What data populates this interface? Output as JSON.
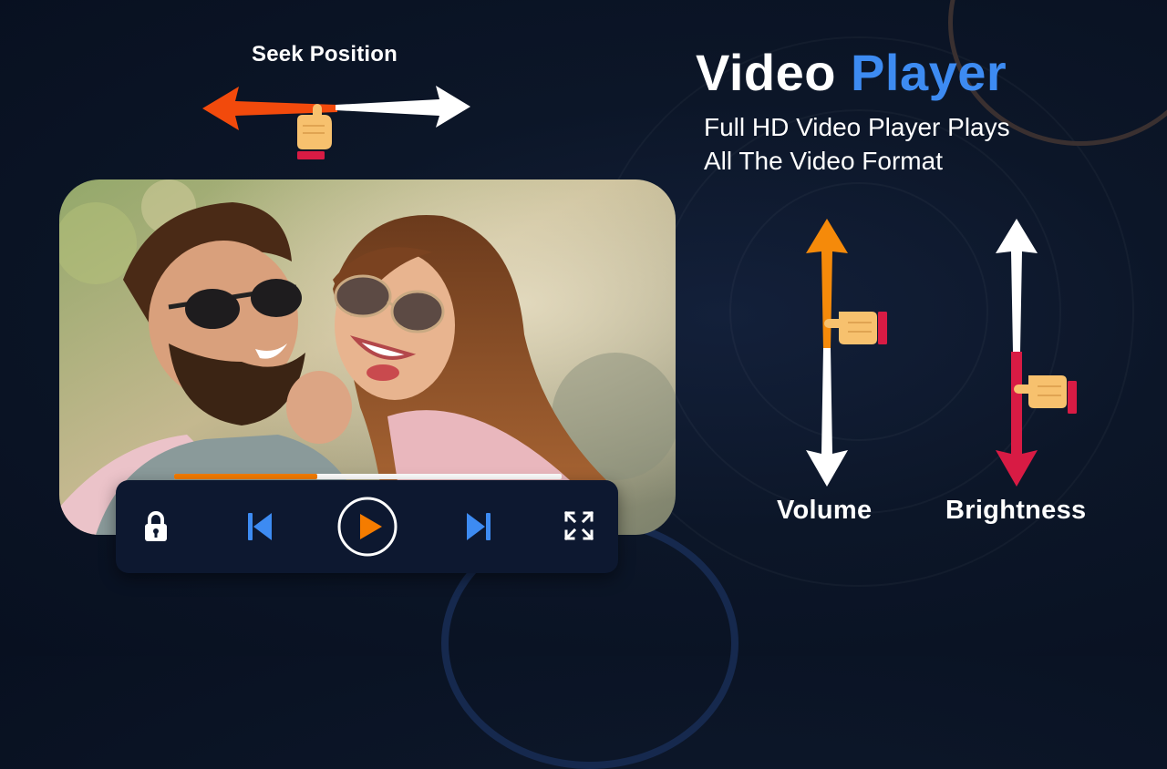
{
  "seek": {
    "label": "Seek Position"
  },
  "header": {
    "title_part1": "Video",
    "title_part2": "Player",
    "subtitle_line1": "Full HD Video Player Plays",
    "subtitle_line2": "All The Video Format"
  },
  "player": {
    "progress_fraction": 0.37,
    "controls": {
      "lock": "lock-icon",
      "previous": "skip-previous-icon",
      "play": "play-icon",
      "next": "skip-next-icon",
      "fullscreen": "fullscreen-icon"
    }
  },
  "gestures": {
    "volume_label": "Volume",
    "brightness_label": "Brightness",
    "volume_level": 0.48,
    "brightness_level": 0.52
  },
  "colors": {
    "accent_blue": "#3d8bf2",
    "accent_orange": "#f57c00",
    "accent_red": "#d81b44",
    "background": "#0b1426"
  }
}
